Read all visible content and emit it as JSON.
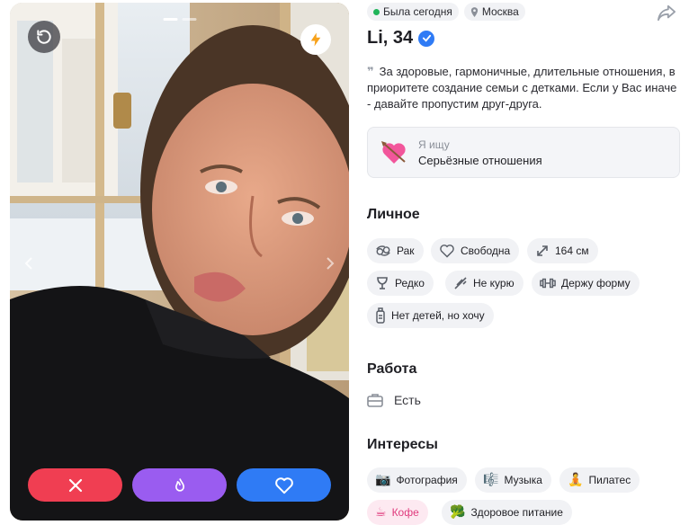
{
  "photo": {
    "progress_segments": 2,
    "active_segment": 0
  },
  "status": {
    "last_seen": "Была сегодня",
    "city": "Москва"
  },
  "profile": {
    "name_age": "Li, 34",
    "verified": true,
    "bio": "За здоровые, гармоничные, длительные отношения, в приоритете создание семьи с детками. Если у Вас иначе - давайте пропустим друг-друга."
  },
  "seeking": {
    "label": "Я ищу",
    "value": "Серьёзные отношения"
  },
  "personal": {
    "title": "Личное",
    "items": [
      {
        "label": "Рак",
        "icon": "zodiac-icon"
      },
      {
        "label": "Свободна",
        "icon": "heart-outline-icon"
      },
      {
        "label": "164 см",
        "icon": "height-arrows-icon"
      },
      {
        "label": "Редко",
        "icon": "wine-glass-icon"
      },
      {
        "label": "Не курю",
        "icon": "no-smoking-icon"
      },
      {
        "label": "Держу форму",
        "icon": "dumbbell-icon"
      },
      {
        "label": "Нет детей, но хочу",
        "icon": "baby-bottle-icon"
      }
    ]
  },
  "work": {
    "title": "Работа",
    "value": "Есть"
  },
  "interests": {
    "title": "Интересы",
    "items": [
      {
        "label": "Фотография",
        "emoji": "📷",
        "highlight": false
      },
      {
        "label": "Музыка",
        "emoji": "🎼",
        "highlight": false
      },
      {
        "label": "Пилатес",
        "emoji": "🧘",
        "highlight": false
      },
      {
        "label": "Кофе",
        "emoji": "☕",
        "highlight": true
      },
      {
        "label": "Здоровое питание",
        "emoji": "🥦",
        "highlight": false
      }
    ]
  },
  "colors": {
    "dislike": "#f03e52",
    "superlike": "#9a5cf0",
    "like": "#2f7bf5",
    "online": "#20b45a",
    "highlight_text": "#e03c7e"
  }
}
